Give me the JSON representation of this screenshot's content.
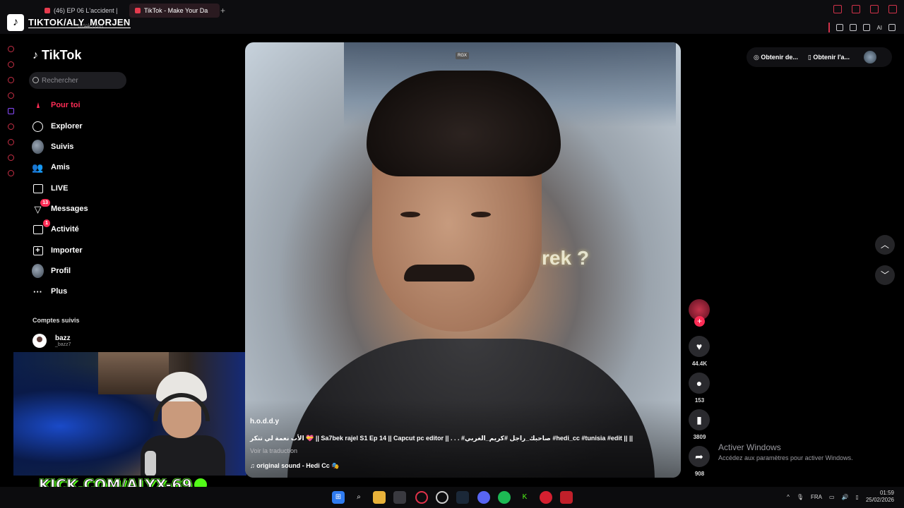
{
  "browser": {
    "tabs": [
      {
        "label": "(46) EP 06 L'accident |"
      },
      {
        "label": "TikTok - Make Your Da"
      }
    ],
    "new_tab": "+",
    "url": "tiktok.com",
    "ai_label": "AI"
  },
  "overlay": {
    "streamer_name": "TIKTOK/ALY_MORJEN",
    "kick_text": "KICK.COM/ALYX-69"
  },
  "sidebar": {
    "logo": "TikTok",
    "search_placeholder": "Rechercher",
    "items": [
      {
        "label": "Pour toi",
        "icon": "home-icon"
      },
      {
        "label": "Explorer",
        "icon": "compass-icon"
      },
      {
        "label": "Suivis",
        "icon": "avatar-icon"
      },
      {
        "label": "Amis",
        "icon": "friends-icon"
      },
      {
        "label": "LIVE",
        "icon": "live-tv-icon"
      },
      {
        "label": "Messages",
        "icon": "paper-plane-icon",
        "badge": "13"
      },
      {
        "label": "Activité",
        "icon": "inbox-icon",
        "badge": "1"
      },
      {
        "label": "Importer",
        "icon": "plus-square-icon"
      },
      {
        "label": "Profil",
        "icon": "profile-avatar-icon"
      },
      {
        "label": "Plus",
        "icon": "more-dots-icon"
      }
    ],
    "followed_heading": "Comptes suivis",
    "followed": [
      {
        "name": "bazz",
        "handle": "_bazz7"
      }
    ]
  },
  "video": {
    "watermark": "RGX",
    "overlay_text": "rek ?",
    "author": "h.o.d.d.y",
    "description": "الأب نعمة لي تنكر 💝 || Sa7bek rajel S1 Ep 14 || Capcut pc editor || . . . #صاحبك_راجل #كريم_الغربي #hedi_cc #tunisia #edit || ||",
    "see_translation": "Voir la traduction",
    "sound": "original sound - Hedi Cc 🎭"
  },
  "actions": {
    "likes": "44.4K",
    "comments": "153",
    "saves": "3809",
    "shares": "908"
  },
  "top_right": {
    "get_coins": "Obtenir de...",
    "get_app": "Obtenir l'a..."
  },
  "windows_watermark": {
    "title": "Activer Windows",
    "subtitle": "Accédez aux paramètres pour activer Windows."
  },
  "taskbar": {
    "lang": "FRA",
    "time": "01:59",
    "date": "25/02/2026"
  },
  "colors": {
    "accent": "#fe2c55",
    "kick_green": "#53fc18",
    "browser_accent": "#d1324a"
  }
}
